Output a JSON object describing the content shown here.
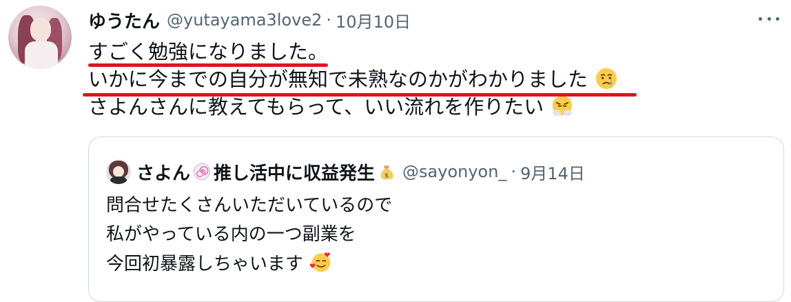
{
  "tweet": {
    "display_name": "ゆうたん",
    "handle": "@yutayama3love2",
    "separator": "·",
    "date": "10月10日",
    "lines": [
      "すごく勉強になりました。",
      "いかに今までの自分が無知で未熟なのかがわかりました",
      "さよんさんに教えてもらって、いい流れを作りたい"
    ],
    "emojis": [
      "crying-face-emoji",
      "steam-from-nose-emoji"
    ]
  },
  "quoted_tweet": {
    "display_name": "さよん",
    "name_suffix": "推し活中に収益発生",
    "handle": "@sayonyon_",
    "separator": "·",
    "date": "9月14日",
    "lines": [
      "問合せたくさんいただいているので",
      "私がやっている内の一つ副業を",
      "今回初暴露しちゃいます"
    ],
    "emojis": [
      "fishcake-swirl-emoji",
      "money-bag-emoji",
      "smiling-face-with-hearts-emoji"
    ]
  },
  "annotations": {
    "underline_color": "#e0141e"
  },
  "colors": {
    "text": "#0f1419",
    "secondary": "#536471",
    "border": "#cfd9de"
  }
}
